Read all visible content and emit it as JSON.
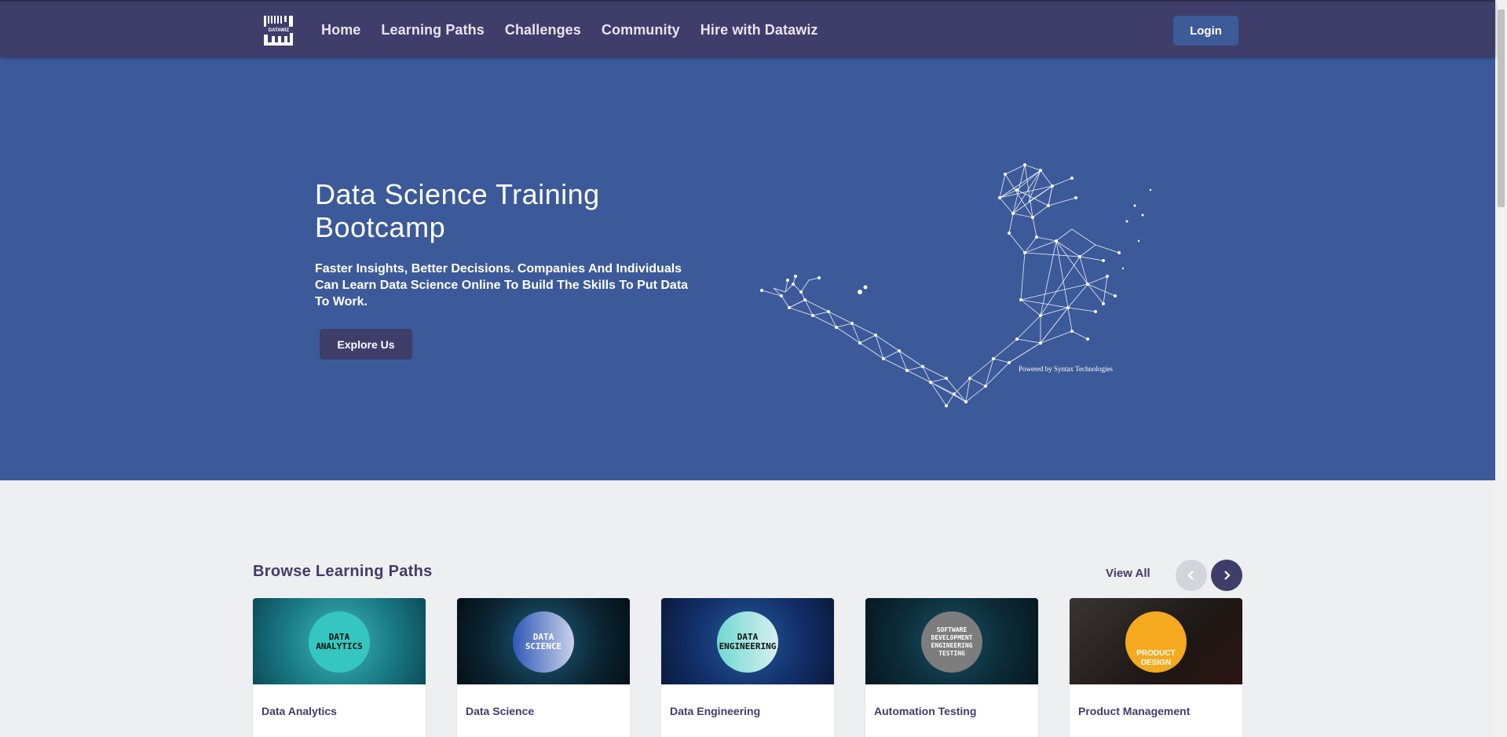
{
  "navbar": {
    "logo_text": "DATAWIZ",
    "links": [
      "Home",
      "Learning Paths",
      "Challenges",
      "Community",
      "Hire with Datawiz"
    ],
    "login_label": "Login"
  },
  "hero": {
    "title": "Data Science Training Bootcamp",
    "subtitle": "Faster Insights, Better Decisions. Companies And Individuals Can Learn Data Science Online To Build The Skills To Put Data To Work.",
    "button_label": "Explore Us",
    "powered_by": "Powered by Syntax Technologies"
  },
  "browse": {
    "title": "Browse Learning Paths",
    "view_all": "View All",
    "cards": [
      {
        "title": "Data Analytics",
        "badge": "DATA ANALYTICS"
      },
      {
        "title": "Data Science",
        "badge": "DATA SCIENCE"
      },
      {
        "title": "Data Engineering",
        "badge": "DATA ENGINEERING"
      },
      {
        "title": "Automation Testing",
        "badge": "SOFTWARE DEVELOPMENT ENGINEERING TESTING"
      },
      {
        "title": "Product Management",
        "badge": "PRODUCT DESIGN"
      }
    ]
  },
  "icons": {
    "prev": "chevron-left-icon",
    "next": "chevron-right-icon"
  },
  "colors": {
    "nav_bg": "#3f3d6a",
    "hero_bg": "#3c5a99",
    "accent": "#3d5a99",
    "page_bg": "#eeeff1"
  }
}
